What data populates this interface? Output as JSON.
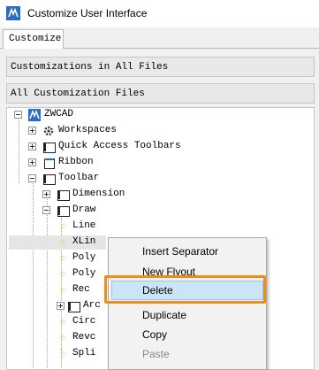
{
  "window": {
    "title": "Customize User Interface"
  },
  "tabs": [
    {
      "label": "Customize"
    }
  ],
  "customizations_header": "Customizations in All Files",
  "filter": {
    "value": "All Customization Files"
  },
  "tree": {
    "root": "ZWCAD",
    "nodes": {
      "workspaces": "Workspaces",
      "quick_access": "Quick Access Toolbars",
      "ribbon": "Ribbon",
      "toolbar": "Toolbar",
      "dimension": "Dimension",
      "draw": "Draw",
      "line": "Line",
      "xline": "XLin",
      "poly1": "Poly",
      "poly2": "Poly",
      "rect": "Rec",
      "arc": "Arc",
      "circ": "Circ",
      "revc": "Revc",
      "spli": "Spli"
    }
  },
  "context_menu": {
    "items": [
      {
        "label": "Insert Separator"
      },
      {
        "label": "New Flyout"
      },
      {
        "label": "Delete"
      },
      {
        "label": "Duplicate"
      },
      {
        "label": "Copy"
      },
      {
        "label": "Paste"
      }
    ]
  },
  "colors": {
    "accent": "#2b6cc4",
    "highlight_border": "#f08c1a",
    "selection": "#cce4f7",
    "star": "#e8b400"
  }
}
